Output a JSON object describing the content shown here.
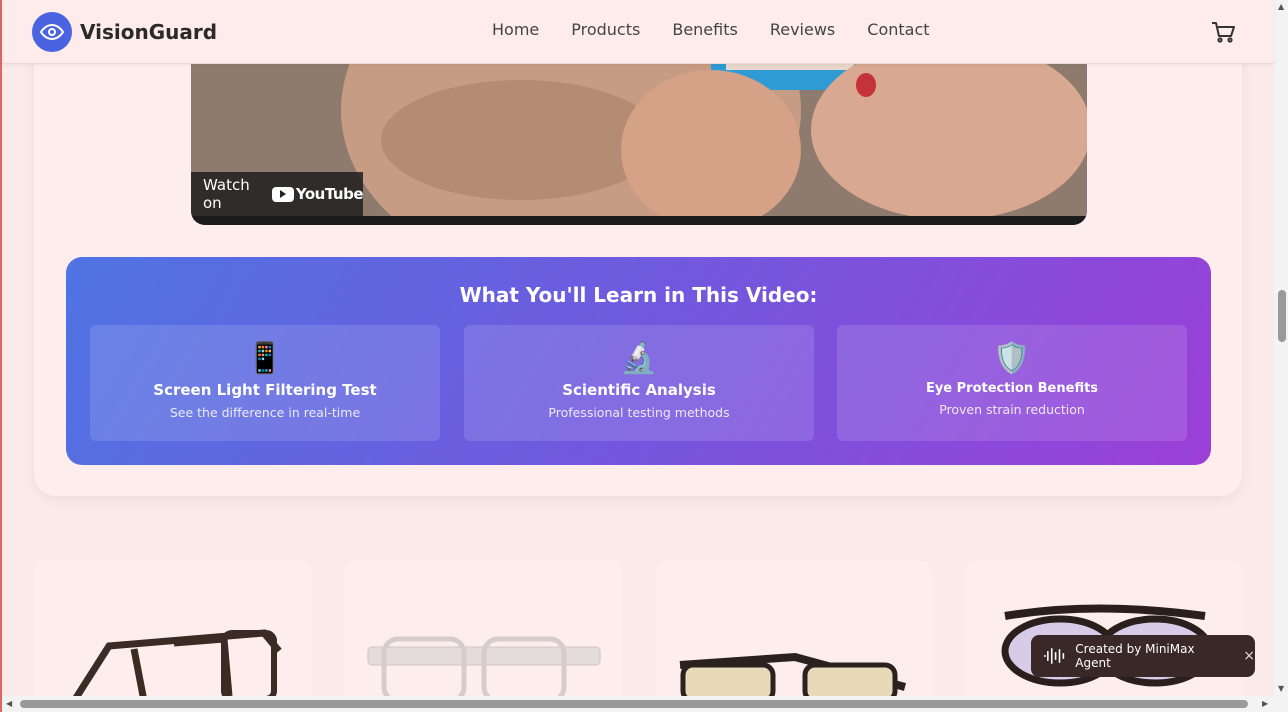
{
  "header": {
    "brand": "VisionGuard",
    "nav": [
      "Home",
      "Products",
      "Benefits",
      "Reviews",
      "Contact"
    ]
  },
  "video": {
    "watch_on": "Watch on",
    "youtube": "YouTube"
  },
  "learn": {
    "title": "What You'll Learn in This Video:",
    "features": [
      {
        "icon": "📱",
        "title": "Screen Light Filtering Test",
        "subtitle": "See the difference in real-time"
      },
      {
        "icon": "🔬",
        "title": "Scientific Analysis",
        "subtitle": "Professional testing methods"
      },
      {
        "icon": "🛡️",
        "title": "Eye Protection Benefits",
        "subtitle": "Proven strain reduction"
      }
    ]
  },
  "toast": {
    "label": "Created by MiniMax Agent",
    "close": "×"
  },
  "colors": {
    "brand": "#4a63e0",
    "gradient_start": "#4f74e3",
    "gradient_end": "#9b3fd8"
  }
}
